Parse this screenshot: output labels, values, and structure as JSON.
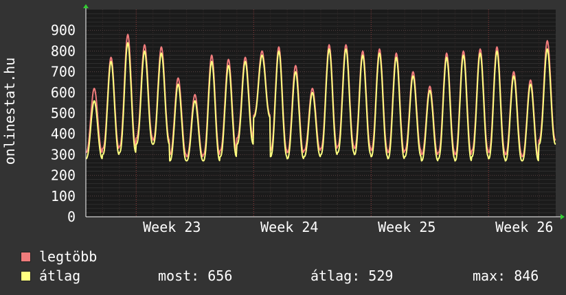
{
  "chart_data": {
    "type": "line",
    "ylabel": "onlinestat.hu",
    "ylim": [
      0,
      1000
    ],
    "yticks": [
      0,
      100,
      200,
      300,
      400,
      500,
      600,
      700,
      800,
      900
    ],
    "xticks": [
      "Week 23",
      "Week 24",
      "Week 25",
      "Week 26"
    ],
    "grid": true,
    "days": 28,
    "series": [
      {
        "name": "legtöbb",
        "color": "#f07c7c",
        "daily_peaks": [
          620,
          770,
          880,
          830,
          820,
          670,
          590,
          780,
          760,
          770,
          800,
          820,
          730,
          620,
          830,
          830,
          800,
          810,
          790,
          700,
          630,
          790,
          800,
          810,
          820,
          700,
          660,
          850
        ],
        "daily_troughs": [
          310,
          330,
          340,
          380,
          370,
          300,
          290,
          300,
          320,
          380,
          490,
          320,
          310,
          320,
          330,
          340,
          330,
          320,
          310,
          320,
          300,
          310,
          300,
          320,
          310,
          300,
          290,
          370
        ]
      },
      {
        "name": "átlag",
        "color": "#ffff80",
        "daily_peaks": [
          560,
          750,
          840,
          800,
          790,
          640,
          560,
          750,
          730,
          750,
          780,
          800,
          700,
          600,
          810,
          810,
          780,
          790,
          770,
          680,
          610,
          770,
          780,
          790,
          800,
          680,
          640,
          810
        ],
        "daily_troughs": [
          280,
          300,
          310,
          350,
          350,
          270,
          270,
          270,
          290,
          350,
          480,
          290,
          280,
          290,
          300,
          310,
          300,
          290,
          280,
          290,
          270,
          280,
          270,
          290,
          280,
          270,
          270,
          350
        ]
      }
    ]
  },
  "legend": {
    "max_label": "legtöbb",
    "avg_label": "átlag",
    "current": "most: 656",
    "average": "átlag: 529",
    "maximum": "max: 846"
  }
}
